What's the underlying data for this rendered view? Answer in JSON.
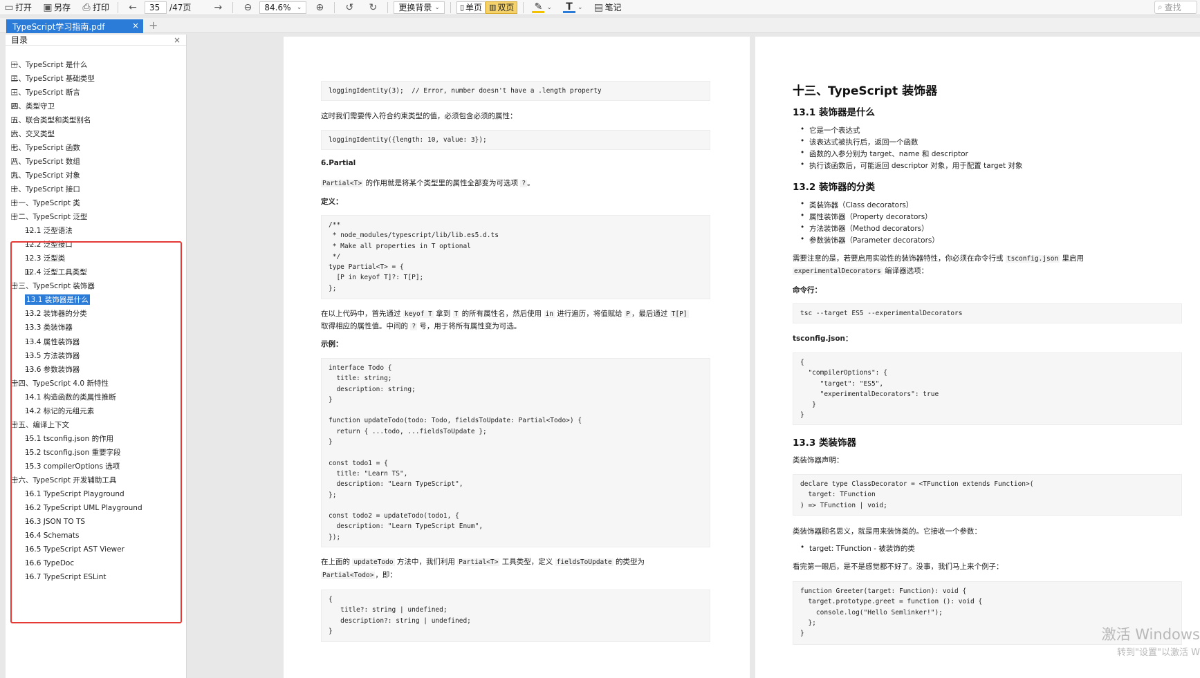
{
  "toolbar": {
    "open_label": "打开",
    "saveas_label": "另存",
    "print_label": "打印",
    "page_current": "35",
    "page_total": "/47页",
    "zoom": "84.6%",
    "background_label": "更换背景",
    "single_page_label": "单页",
    "double_page_label": "双页",
    "notes_label": "笔记",
    "search_placeholder": "查找"
  },
  "tabs": [
    {
      "label": "TypeScript学习指南.pdf"
    }
  ],
  "sidebar": {
    "title": "目录",
    "items": [
      {
        "label": "一、TypeScript 是什么",
        "level": 0,
        "expander": "+"
      },
      {
        "label": "二、TypeScript 基础类型",
        "level": 0,
        "expander": "+"
      },
      {
        "label": "三、TypeScript 断言",
        "level": 0,
        "expander": "+"
      },
      {
        "label": "四、类型守卫",
        "level": 0,
        "expander": "+"
      },
      {
        "label": "五、联合类型和类型别名",
        "level": 0,
        "expander": "+"
      },
      {
        "label": "六、交叉类型",
        "level": 0,
        "expander": "+"
      },
      {
        "label": "七、TypeScript 函数",
        "level": 0,
        "expander": "+"
      },
      {
        "label": "八、TypeScript 数组",
        "level": 0,
        "expander": "+"
      },
      {
        "label": "九、TypeScript 对象",
        "level": 0,
        "expander": "+"
      },
      {
        "label": "十、TypeScript 接口",
        "level": 0,
        "expander": "+"
      },
      {
        "label": "十一、TypeScript 类",
        "level": 0,
        "expander": "+"
      },
      {
        "label": "十二、TypeScript 泛型",
        "level": 0,
        "expander": "-"
      },
      {
        "label": "12.1 泛型语法",
        "level": 1,
        "expander": ""
      },
      {
        "label": "12.2 泛型接口",
        "level": 1,
        "expander": ""
      },
      {
        "label": "12.3 泛型类",
        "level": 1,
        "expander": ""
      },
      {
        "label": "12.4 泛型工具类型",
        "level": 1,
        "expander": "+"
      },
      {
        "label": "十三、TypeScript 装饰器",
        "level": 0,
        "expander": "-"
      },
      {
        "label": "13.1 装饰器是什么",
        "level": 1,
        "expander": "",
        "selected": true
      },
      {
        "label": "13.2 装饰器的分类",
        "level": 1,
        "expander": ""
      },
      {
        "label": "13.3 类装饰器",
        "level": 1,
        "expander": ""
      },
      {
        "label": "13.4 属性装饰器",
        "level": 1,
        "expander": ""
      },
      {
        "label": "13.5 方法装饰器",
        "level": 1,
        "expander": ""
      },
      {
        "label": "13.6 参数装饰器",
        "level": 1,
        "expander": ""
      },
      {
        "label": "十四、TypeScript 4.0 新特性",
        "level": 0,
        "expander": "-"
      },
      {
        "label": "14.1 构造函数的类属性推断",
        "level": 1,
        "expander": ""
      },
      {
        "label": "14.2 标记的元组元素",
        "level": 1,
        "expander": ""
      },
      {
        "label": "十五、编译上下文",
        "level": 0,
        "expander": "-"
      },
      {
        "label": "15.1 tsconfig.json 的作用",
        "level": 1,
        "expander": ""
      },
      {
        "label": "15.2 tsconfig.json 重要字段",
        "level": 1,
        "expander": ""
      },
      {
        "label": "15.3 compilerOptions 选项",
        "level": 1,
        "expander": ""
      },
      {
        "label": "十六、TypeScript 开发辅助工具",
        "level": 0,
        "expander": "-"
      },
      {
        "label": "16.1 TypeScript Playground",
        "level": 1,
        "expander": ""
      },
      {
        "label": "16.2 TypeScript UML Playground",
        "level": 1,
        "expander": ""
      },
      {
        "label": "16.3 JSON TO TS",
        "level": 1,
        "expander": ""
      },
      {
        "label": "16.4 Schemats",
        "level": 1,
        "expander": ""
      },
      {
        "label": "16.5 TypeScript AST Viewer",
        "level": 1,
        "expander": ""
      },
      {
        "label": "16.6 TypeDoc",
        "level": 1,
        "expander": ""
      },
      {
        "label": "16.7 TypeScript ESLint",
        "level": 1,
        "expander": ""
      }
    ]
  },
  "left_page": {
    "code1": "loggingIdentity(3);  // Error, number doesn't have a .length property",
    "p1": "这时我们需要传入符合约束类型的值，必须包含必须的属性：",
    "code2": "loggingIdentity({length: 10, value: 3});",
    "h_partial": "6.Partial",
    "p2_code": "Partial<T>",
    "p2_text": " 的作用就是将某个类型里的属性全部变为可选项 ",
    "p2_code2": "?",
    "p2_end": "。",
    "def_label": "定义：",
    "code3": "/**\n * node_modules/typescript/lib/lib.es5.d.ts\n * Make all properties in T optional\n */\ntype Partial<T> = {\n  [P in keyof T]?: T[P];\n};",
    "p3_a": "在以上代码中，首先通过 ",
    "p3_c1": "keyof T",
    "p3_b": " 拿到 ",
    "p3_c2": "T",
    "p3_c": " 的所有属性名，然后使用 ",
    "p3_c3": "in",
    "p3_d": " 进行遍历，将值赋给 ",
    "p3_c4": "P",
    "p3_e": "，最后通过 ",
    "p3_c5": "T[P]",
    "p3_line2_a": "取得相应的属性值。中间的 ",
    "p3_line2_c": "?",
    "p3_line2_b": " 号，用于将所有属性变为可选。",
    "example_label": "示例：",
    "code4": "interface Todo {\n  title: string;\n  description: string;\n}\n\nfunction updateTodo(todo: Todo, fieldsToUpdate: Partial<Todo>) {\n  return { ...todo, ...fieldsToUpdate };\n}\n\nconst todo1 = {\n  title: \"Learn TS\",\n  description: \"Learn TypeScript\",\n};\n\nconst todo2 = updateTodo(todo1, {\n  description: \"Learn TypeScript Enum\",\n});",
    "p4_a": "在上面的 ",
    "p4_c1": "updateTodo",
    "p4_b": " 方法中，我们利用 ",
    "p4_c2": "Partial<T>",
    "p4_c": " 工具类型，定义 ",
    "p4_c3": "fieldsToUpdate",
    "p4_d": " 的类型为",
    "p4_line2_c": "Partial<Todo>",
    "p4_line2_b": "，即：",
    "code5": "{\n   title?: string | undefined;\n   description?: string | undefined;\n}"
  },
  "right_page": {
    "h_main": "十三、TypeScript 装饰器",
    "h_131": "13.1 装饰器是什么",
    "bullets1": [
      "它是一个表达式",
      "该表达式被执行后，返回一个函数",
      "函数的入参分别为 target、name 和 descriptor",
      "执行该函数后，可能返回 descriptor 对象，用于配置 target 对象"
    ],
    "h_132": "13.2 装饰器的分类",
    "bullets2": [
      "类装饰器（Class decorators）",
      "属性装饰器（Property decorators）",
      "方法装饰器（Method decorators）",
      "参数装饰器（Parameter decorators）"
    ],
    "p1_a": "需要注意的是，若要启用实验性的装饰器特性，你必须在命令行或 ",
    "p1_c1": "tsconfig.json",
    "p1_b": " 里启用",
    "p1_line2_c": "experimentalDecorators",
    "p1_line2_b": " 编译器选项：",
    "cmd_label": "命令行：",
    "code1": "tsc --target ES5 --experimentalDecorators",
    "tsconfig_label": "tsconfig.json：",
    "code2": "{\n  \"compilerOptions\": {\n     \"target\": \"ES5\",\n     \"experimentalDecorators\": true\n   }\n}",
    "h_133": "13.3 类装饰器",
    "p2": "类装饰器声明：",
    "code3": "declare type ClassDecorator = <TFunction extends Function>(\n  target: TFunction\n) => TFunction | void;",
    "p3": "类装饰器顾名思义，就是用来装饰类的。它接收一个参数：",
    "bullets3": [
      "target: TFunction - 被装饰的类"
    ],
    "p4": "看完第一眼后，是不是感觉都不好了。没事，我们马上来个例子：",
    "code4": "function Greeter(target: Function): void {\n  target.prototype.greet = function (): void {\n    console.log(\"Hello Semlinker!\");\n  };\n}"
  },
  "watermark": {
    "line1": "激活 Windows",
    "line2": "转到\"设置\"以激活 W"
  }
}
